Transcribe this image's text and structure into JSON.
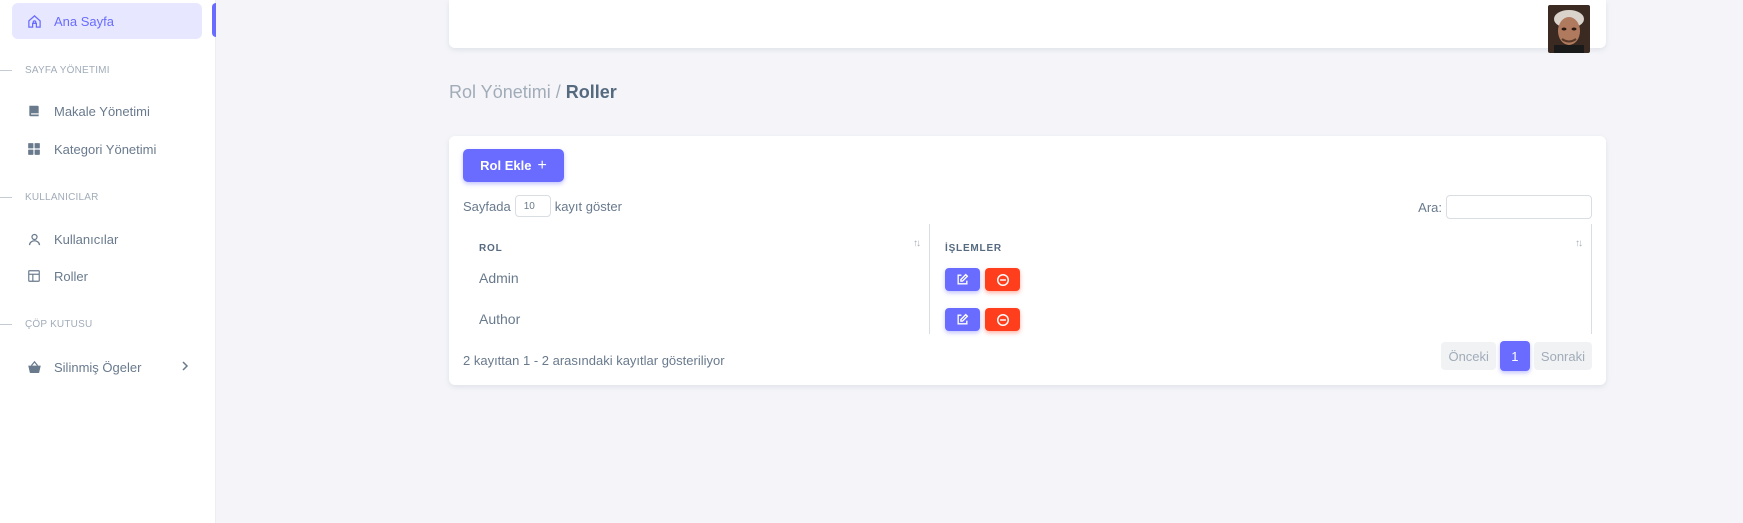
{
  "sidebar": {
    "home": "Ana Sayfa",
    "section_pages": "SAYFA YÖNETIMI",
    "articles": "Makale Yönetimi",
    "categories": "Kategori Yönetimi",
    "section_users": "KULLANICILAR",
    "users": "Kullanıcılar",
    "roles": "Roller",
    "section_trash": "ÇÖP KUTUSU",
    "deleted_items": "Silinmiş Ögeler"
  },
  "breadcrumb": {
    "parent": "Rol Yönetimi /",
    "current": "Roller"
  },
  "toolbar": {
    "add_role": "Rol Ekle",
    "length_prefix": "Sayfada",
    "length_value": "10",
    "length_suffix": "kayıt göster",
    "search_label": "Ara:"
  },
  "table": {
    "columns": [
      "ROL",
      "İŞLEMLER"
    ],
    "rows": [
      {
        "role": "Admin"
      },
      {
        "role": "Author"
      }
    ]
  },
  "footer": {
    "info": "2 kayıttan 1 - 2 arasındaki kayıtlar gösteriliyor",
    "prev": "Önceki",
    "page": "1",
    "next": "Sonraki"
  },
  "colors": {
    "primary": "#696cff",
    "danger": "#ff3e1d",
    "background": "#f5f5f9"
  }
}
